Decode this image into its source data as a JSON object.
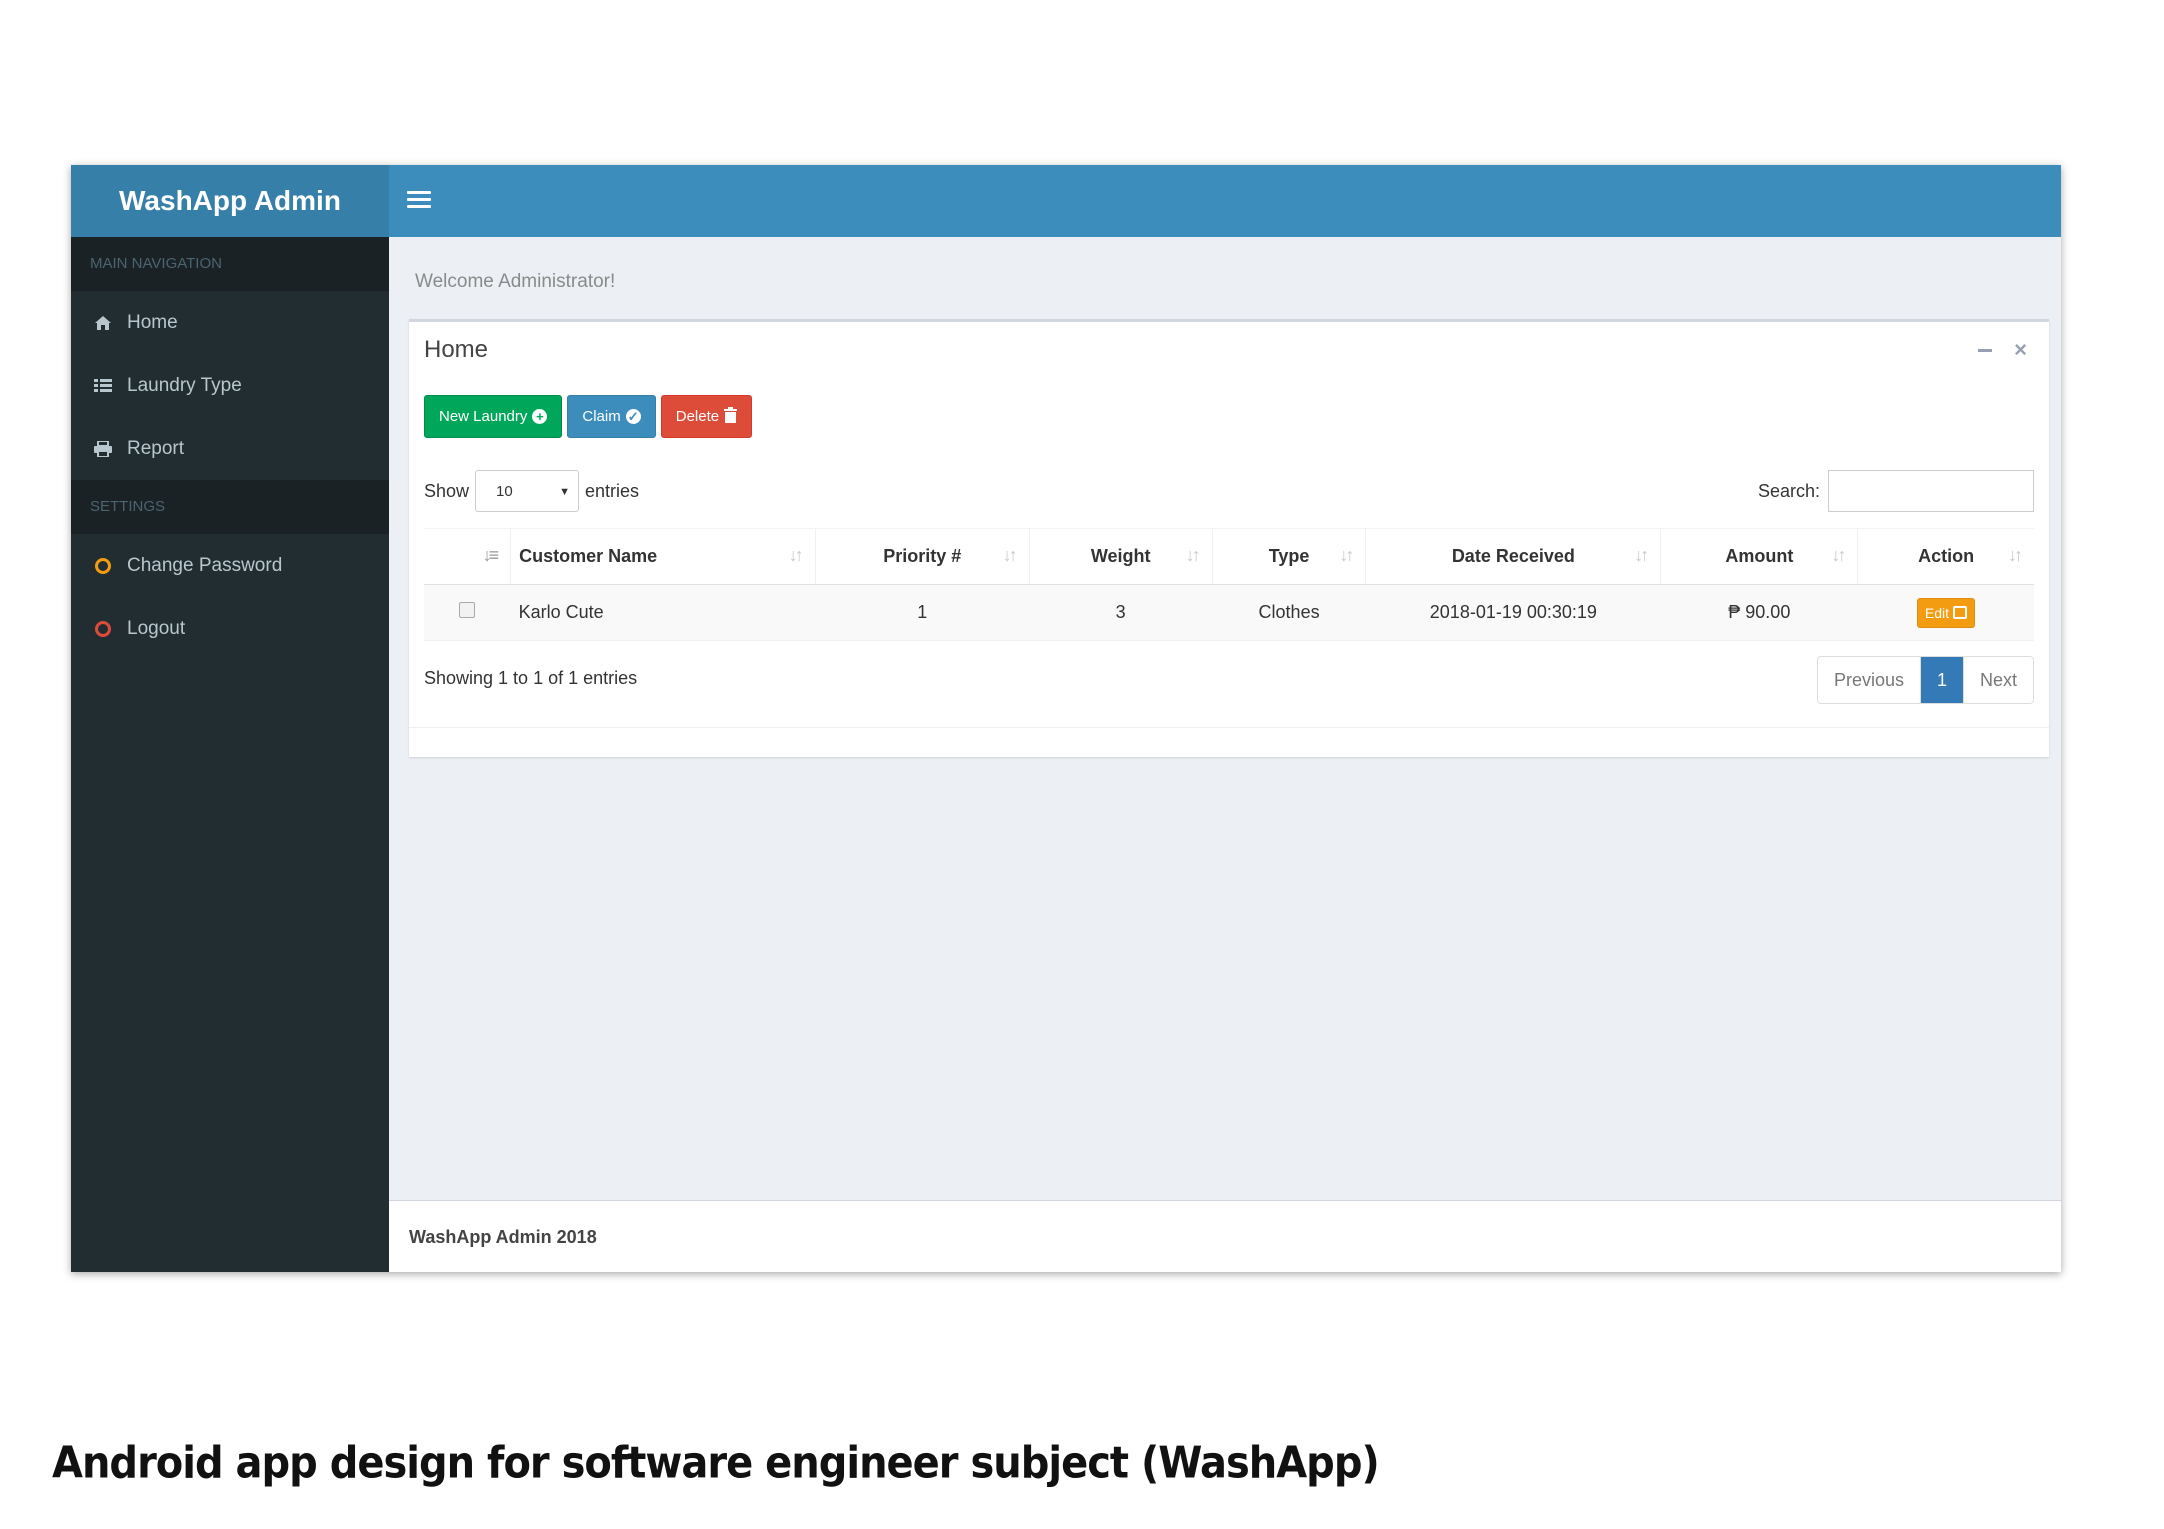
{
  "header": {
    "app_title": "WashApp Admin"
  },
  "sidebar": {
    "sections": [
      {
        "label": "MAIN NAVIGATION"
      },
      {
        "label": "SETTINGS"
      }
    ],
    "items": [
      {
        "label": "Home",
        "icon": "home-icon"
      },
      {
        "label": "Laundry Type",
        "icon": "list-icon"
      },
      {
        "label": "Report",
        "icon": "print-icon"
      },
      {
        "label": "Change Password",
        "icon": "circle-icon",
        "color": "#f39c12"
      },
      {
        "label": "Logout",
        "icon": "circle-icon",
        "color": "#dd4b39"
      }
    ]
  },
  "content": {
    "welcome": "Welcome Administrator!",
    "box_title": "Home",
    "buttons": {
      "new_laundry": "New Laundry",
      "claim": "Claim",
      "delete": "Delete"
    },
    "show_label": "Show",
    "entries_value": "10",
    "entries_label": "entries",
    "search_label": "Search:",
    "table": {
      "columns": [
        "Customer Name",
        "Priority #",
        "Weight",
        "Type",
        "Date Received",
        "Amount",
        "Action"
      ],
      "rows": [
        {
          "customer": "Karlo Cute",
          "priority": "1",
          "weight": "3",
          "type": "Clothes",
          "date": "2018-01-19 00:30:19",
          "amount": "₱ 90.00",
          "action": "Edit"
        }
      ]
    },
    "info": "Showing 1 to 1 of 1 entries",
    "pagination": {
      "previous": "Previous",
      "current": "1",
      "next": "Next"
    }
  },
  "footer": {
    "text": "WashApp Admin 2018"
  },
  "caption": "Android app design for software engineer subject (WashApp)",
  "colors": {
    "header": "#3c8dbc",
    "sidebar": "#222d32",
    "green": "#00a65a",
    "blue": "#3c8dbc",
    "red": "#dd4b39",
    "orange": "#f39c12"
  }
}
